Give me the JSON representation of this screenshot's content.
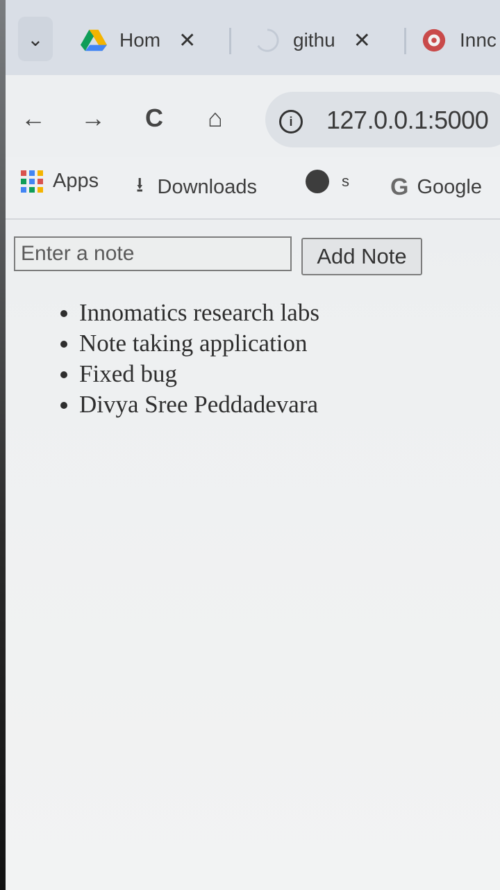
{
  "tabs": [
    {
      "title": "Hom",
      "close": "✕"
    },
    {
      "title": "githu",
      "close": "✕"
    },
    {
      "title": "Innc"
    }
  ],
  "toolbar": {
    "back_icon": "←",
    "forward_icon": "→",
    "reload_icon": "C",
    "home_icon": "⌂",
    "url": "127.0.0.1:5000"
  },
  "bookmarks": [
    {
      "label": "Apps",
      "icon": "apps-grid-icon"
    },
    {
      "label": "Downloads",
      "icon": "download-icon"
    },
    {
      "label": "s",
      "icon": "globe-icon"
    },
    {
      "label": "Google",
      "icon": "google-icon"
    }
  ],
  "page": {
    "input_placeholder": "Enter a note",
    "add_button_label": "Add Note",
    "notes": [
      "Innomatics research labs",
      "Note taking application",
      "Fixed bug",
      "Divya Sree Peddadevara"
    ]
  }
}
